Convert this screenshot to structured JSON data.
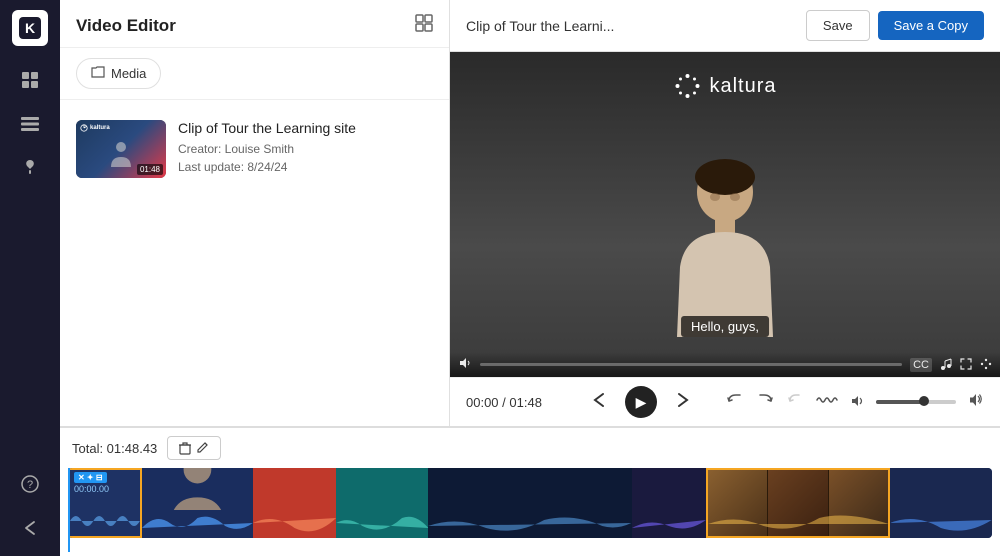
{
  "sidebar": {
    "logo": "K",
    "items": [
      {
        "id": "home",
        "icon": "⊞",
        "active": false
      },
      {
        "id": "media",
        "icon": "▤",
        "active": false
      },
      {
        "id": "quiz",
        "icon": "↩",
        "active": false
      }
    ],
    "bottom_items": [
      {
        "id": "help",
        "icon": "?"
      },
      {
        "id": "back",
        "icon": "↩"
      }
    ]
  },
  "left_panel": {
    "title": "Video Editor",
    "expand_icon": "⬜",
    "tab_label": "Media",
    "tab_icon": "📁",
    "media_item": {
      "name": "Clip of Tour the Learning site",
      "creator": "Creator: Louise Smith",
      "last_update": "Last update: 8/24/24",
      "duration": "01:48"
    }
  },
  "video_panel": {
    "title": "Clip of Tour the Learni...",
    "save_label": "Save",
    "save_copy_label": "Save a Copy",
    "kaltura_text": "kaltura",
    "subtitle": "Hello, guys,",
    "time_current": "00:00",
    "time_separator": "/",
    "time_total": "01:48",
    "controls": {
      "back_icon": "←",
      "play_icon": "▶",
      "forward_icon": "→",
      "undo_icon": "↺",
      "redo_icon": "↻",
      "undo2_icon": "↶",
      "waveform_icon": "〜",
      "volume_up_icon": "▲",
      "volume_max_icon": "▲▲"
    }
  },
  "timeline": {
    "total_label": "Total: 01:48.43",
    "tool_icons": [
      "🗑",
      "✏"
    ],
    "segments": [
      {
        "color": "#162850",
        "width": 8
      },
      {
        "color": "#1a2d6b",
        "width": 15
      },
      {
        "color": "#c0392b",
        "width": 10
      },
      {
        "color": "#1a5a6e",
        "width": 12
      },
      {
        "color": "#162042",
        "width": 25
      },
      {
        "color": "#6d1a2e",
        "width": 10
      },
      {
        "color": "#1a2850",
        "width": 8
      },
      {
        "color": "#7a5a1a",
        "width": 12
      }
    ]
  }
}
